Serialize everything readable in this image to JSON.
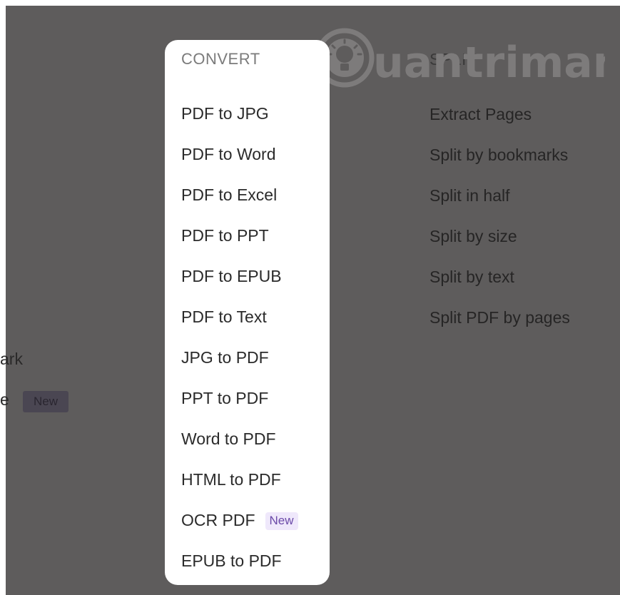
{
  "background": {
    "left_items": [
      "ark",
      "e"
    ],
    "left_badge": "New"
  },
  "split": {
    "heading": "SPLIT",
    "items": [
      "Extract Pages",
      "Split by bookmarks",
      "Split in half",
      "Split by size",
      "Split by text",
      "Split PDF by pages"
    ]
  },
  "convert": {
    "heading": "CONVERT",
    "items": [
      {
        "label": "PDF to JPG"
      },
      {
        "label": "PDF to Word"
      },
      {
        "label": "PDF to Excel"
      },
      {
        "label": "PDF to PPT"
      },
      {
        "label": "PDF to EPUB"
      },
      {
        "label": "PDF to Text"
      },
      {
        "label": "JPG to PDF"
      },
      {
        "label": "PPT to PDF"
      },
      {
        "label": "Word to PDF"
      },
      {
        "label": "HTML to PDF"
      },
      {
        "label": "OCR PDF",
        "badge": "New"
      },
      {
        "label": "EPUB to PDF"
      }
    ]
  },
  "watermark": {
    "text": "uantrimang"
  },
  "colors": {
    "overlay": "#5e5c5c",
    "menu_bg": "#ffffff",
    "badge_bg": "#efe8fb",
    "badge_text": "#6b4aa8"
  }
}
